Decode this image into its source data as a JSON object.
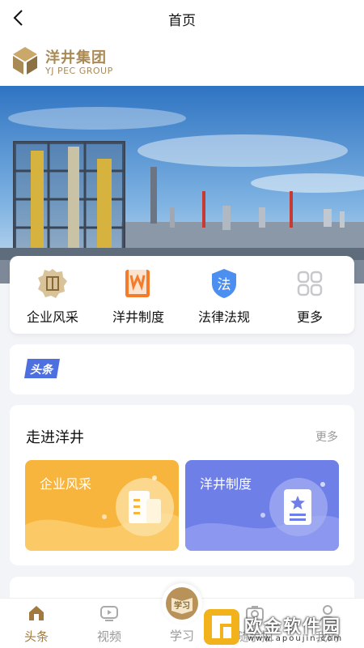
{
  "topbar": {
    "title": "首页"
  },
  "brand": {
    "name_cn": "洋井集团",
    "name_en": "YJ PEC GROUP"
  },
  "quick_links": [
    {
      "label": "企业风采",
      "icon": "building-badge-icon"
    },
    {
      "label": "洋井制度",
      "icon": "book-icon"
    },
    {
      "label": "法律法规",
      "icon": "law-shield-icon",
      "glyph": "法"
    },
    {
      "label": "更多",
      "icon": "grid-more-icon"
    }
  ],
  "headline": {
    "badge": "头条"
  },
  "section": {
    "title": "走进洋井",
    "more": "更多",
    "cards": [
      {
        "label": "企业风采",
        "color": "#f8b53d"
      },
      {
        "label": "洋井制度",
        "color": "#6f7fe8"
      }
    ]
  },
  "tabbar": {
    "tabs": [
      {
        "label": "头条",
        "active": true
      },
      {
        "label": "视频",
        "active": false
      },
      {
        "label": "学习",
        "active": false,
        "badge": "学习"
      },
      {
        "label": "随手拍",
        "active": false
      },
      {
        "label": "我的",
        "active": false
      }
    ]
  },
  "watermark": {
    "text": "欧金软件园",
    "url": "www.apoujin.com"
  },
  "colors": {
    "brand_gold": "#a98a55",
    "accent_orange": "#f8b53d",
    "accent_blue": "#6f7fe8",
    "background": "#f3f4f7"
  }
}
